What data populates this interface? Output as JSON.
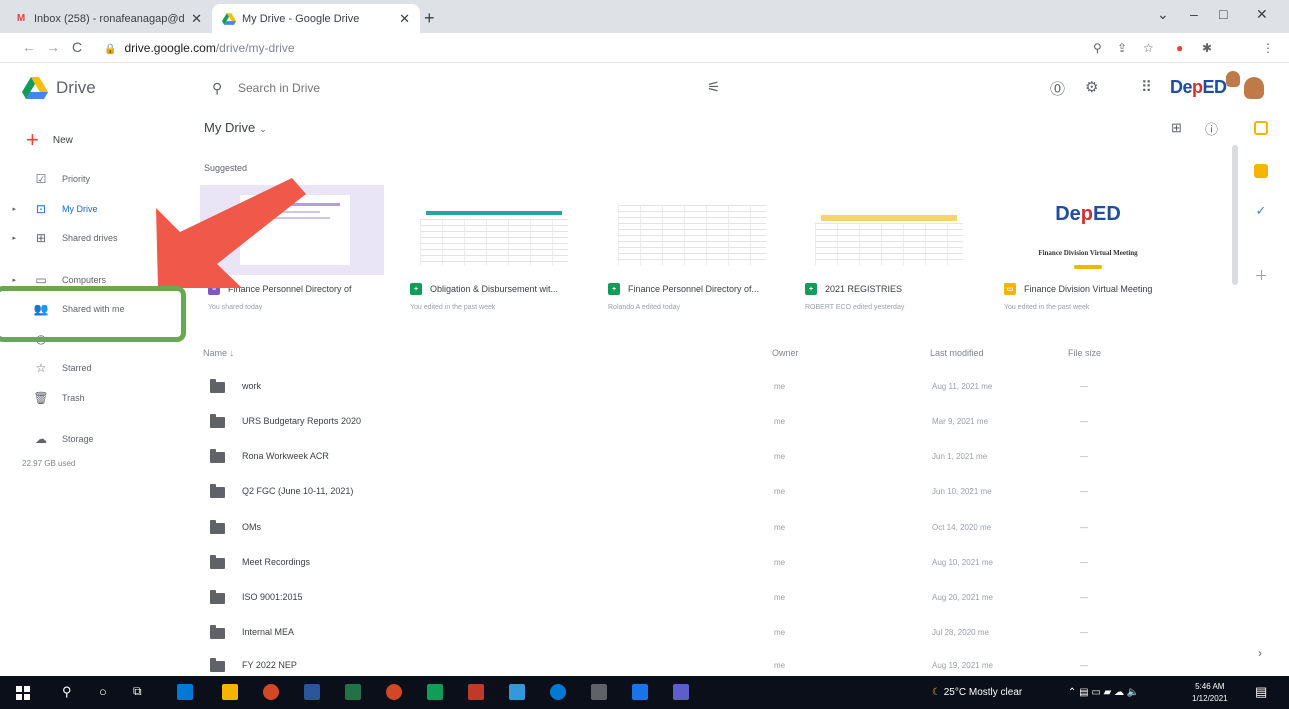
{
  "browser": {
    "tabs": [
      {
        "title": "Inbox (258) - ronafeanagap@d",
        "active": false
      },
      {
        "title": "My Drive - Google Drive",
        "active": true
      }
    ],
    "new_tab": "+",
    "window_controls": [
      "⌄",
      "–",
      "□",
      "✕"
    ],
    "nav": [
      "←",
      "→",
      "C"
    ],
    "url_host": "drive.google.com",
    "url_path": "/drive/my-drive"
  },
  "header": {
    "app_name": "Drive",
    "search_placeholder": "Search in Drive",
    "brand_prefix": "De",
    "brand_mid": "p",
    "brand_suffix": "ED"
  },
  "sidebar": {
    "new_label": "New",
    "items": [
      {
        "label": "Priority",
        "icon": "checkbox-icon"
      },
      {
        "label": "My Drive",
        "icon": "drive-icon"
      },
      {
        "label": "Shared drives",
        "icon": "shared-drives-icon"
      },
      {
        "label": "Computers",
        "icon": "computer-icon"
      },
      {
        "label": "Shared with me",
        "icon": "people-icon"
      },
      {
        "label": "Starred",
        "icon": "star-icon"
      },
      {
        "label": "Trash",
        "icon": "trash-icon"
      },
      {
        "label": "Storage",
        "icon": "cloud-icon"
      }
    ],
    "storage_used": "22.97 GB used"
  },
  "main": {
    "title": "My Drive",
    "suggested_label": "Suggested",
    "suggested": [
      {
        "name": "Finance Personnel Directory of",
        "sub": "You shared today",
        "type": "form",
        "color": "#7e57c2"
      },
      {
        "name": "Obligation & Disbursement wit...",
        "sub": "You edited in the past week",
        "type": "sheet",
        "color": "#0f9d58"
      },
      {
        "name": "Finance Personnel Directory of...",
        "sub": "Rolando A edited today",
        "type": "sheet",
        "color": "#0f9d58"
      },
      {
        "name": "2021 REGISTRIES",
        "sub": "ROBERT ECO edited yesterday",
        "type": "sheet",
        "color": "#0f9d58"
      },
      {
        "name": "Finance Division Virtual Meeting",
        "sub": "You edited in the past week",
        "type": "slides",
        "color": "#f4b400"
      }
    ],
    "deped_thumb_title": "Finance Division Virtual Meeting",
    "columns": {
      "name": "Name",
      "owner": "Owner",
      "modified": "Last modified",
      "size": "File size"
    },
    "rows": [
      {
        "name": "work",
        "owner": "me",
        "modified": "Aug 11, 2021 me",
        "size": "—"
      },
      {
        "name": "URS Budgetary Reports 2020",
        "owner": "me",
        "modified": "Mar 9, 2021 me",
        "size": "—"
      },
      {
        "name": "Rona Workweek ACR",
        "owner": "me",
        "modified": "Jun 1, 2021 me",
        "size": "—"
      },
      {
        "name": "Q2 FGC (June 10-11, 2021)",
        "owner": "me",
        "modified": "Jun 10, 2021 me",
        "size": "—"
      },
      {
        "name": "OMs",
        "owner": "me",
        "modified": "Oct 14, 2020 me",
        "size": "—"
      },
      {
        "name": "Meet Recordings",
        "owner": "me",
        "modified": "Aug 10, 2021 me",
        "size": "—"
      },
      {
        "name": "ISO 9001:2015",
        "owner": "me",
        "modified": "Aug 20, 2021 me",
        "size": "—"
      },
      {
        "name": "Internal MEA",
        "owner": "me",
        "modified": "Jul 28, 2020 me",
        "size": "—"
      },
      {
        "name": "FY 2022 NEP",
        "owner": "me",
        "modified": "Aug 19, 2021 me",
        "size": "—"
      }
    ]
  },
  "taskbar": {
    "weather": "25°C Mostly clear",
    "time": "5:46 AM",
    "date": "1/12/2021"
  },
  "colors": {
    "highlight": "#6aa84f",
    "arrow": "#f0584a",
    "drive_blue": "#1967d2"
  }
}
